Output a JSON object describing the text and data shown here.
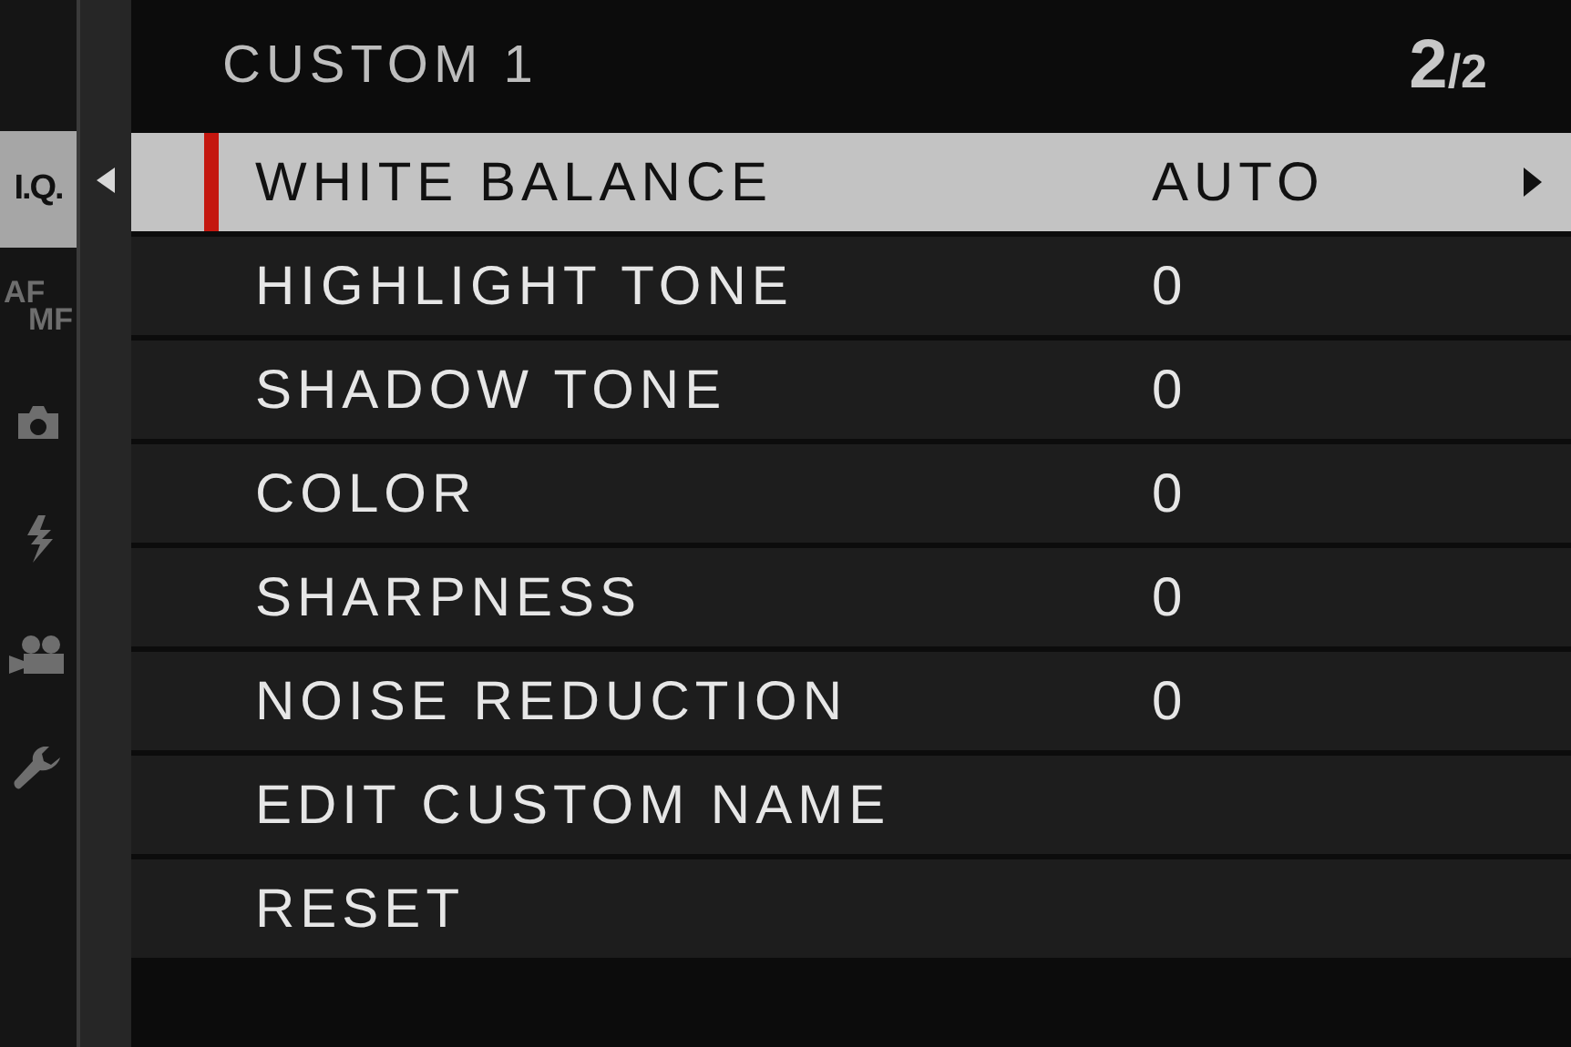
{
  "header": {
    "title": "CUSTOM 1",
    "page": "2",
    "page_total": "/2"
  },
  "sidebar_tabs": [
    {
      "kind": "text",
      "label": "I.Q.",
      "selected": true
    },
    {
      "kind": "stacked",
      "label": "AF",
      "label2": "MF",
      "selected": false
    },
    {
      "kind": "camera",
      "selected": false
    },
    {
      "kind": "flash",
      "selected": false
    },
    {
      "kind": "movie",
      "selected": false
    },
    {
      "kind": "wrench",
      "selected": false
    }
  ],
  "items": [
    {
      "label": "WHITE BALANCE",
      "value": "AUTO",
      "selected": true,
      "submenu": true
    },
    {
      "label": "HIGHLIGHT TONE",
      "value": "0",
      "selected": false,
      "submenu": false
    },
    {
      "label": "SHADOW TONE",
      "value": "0",
      "selected": false,
      "submenu": false
    },
    {
      "label": "COLOR",
      "value": "0",
      "selected": false,
      "submenu": false
    },
    {
      "label": "SHARPNESS",
      "value": "0",
      "selected": false,
      "submenu": false
    },
    {
      "label": "NOISE REDUCTION",
      "value": "0",
      "selected": false,
      "submenu": false
    },
    {
      "label": "EDIT CUSTOM NAME",
      "selected": false,
      "submenu": false
    },
    {
      "label": "RESET",
      "selected": false,
      "submenu": false
    }
  ]
}
